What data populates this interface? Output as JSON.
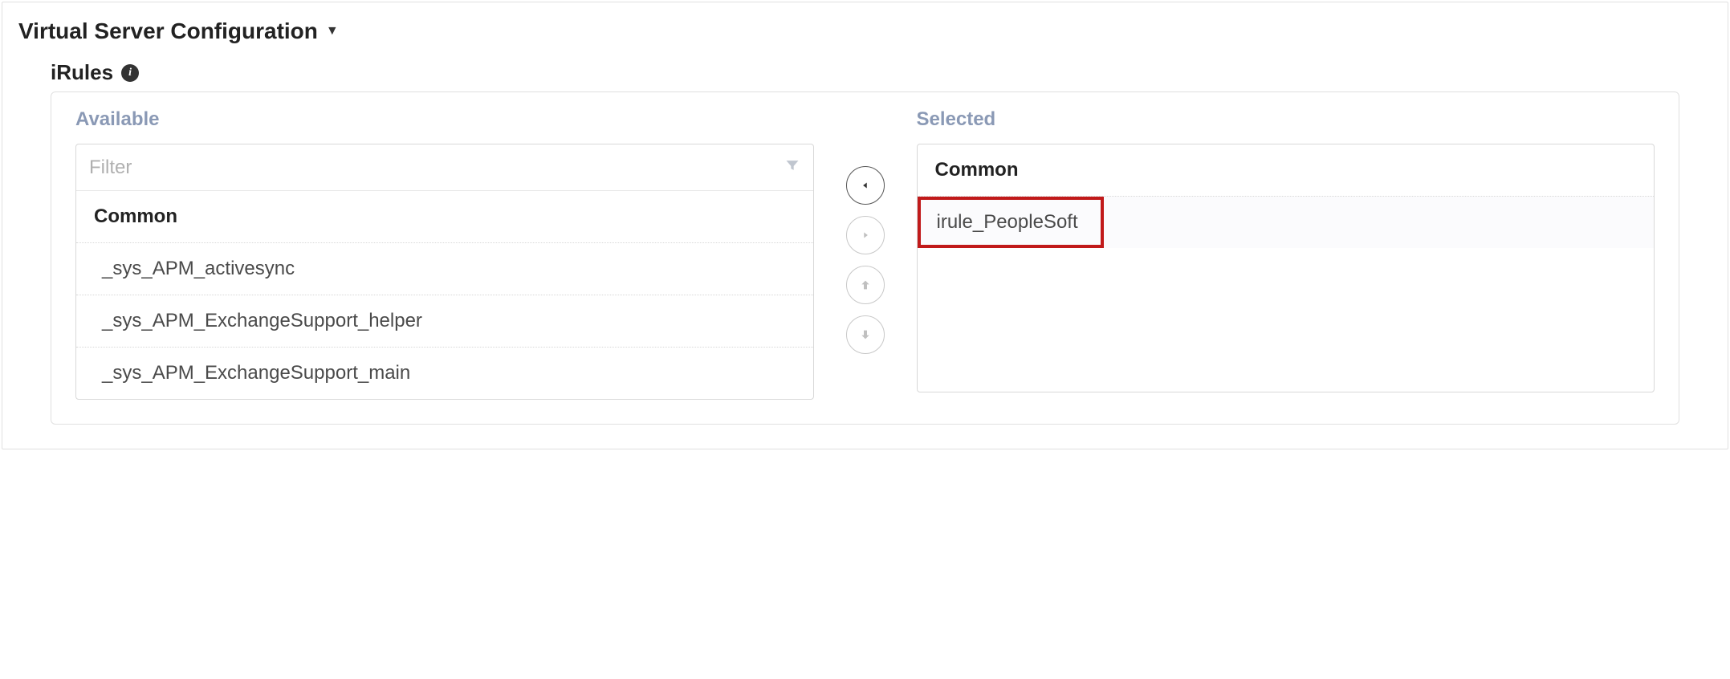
{
  "section": {
    "title": "Virtual Server Configuration"
  },
  "irules": {
    "label": "iRules",
    "available_title": "Available",
    "selected_title": "Selected",
    "filter_placeholder": "Filter",
    "available_group": "Common",
    "available_items": [
      "_sys_APM_activesync",
      "_sys_APM_ExchangeSupport_helper",
      "_sys_APM_ExchangeSupport_main"
    ],
    "selected_group": "Common",
    "selected_items": [
      "irule_PeopleSoft"
    ]
  }
}
